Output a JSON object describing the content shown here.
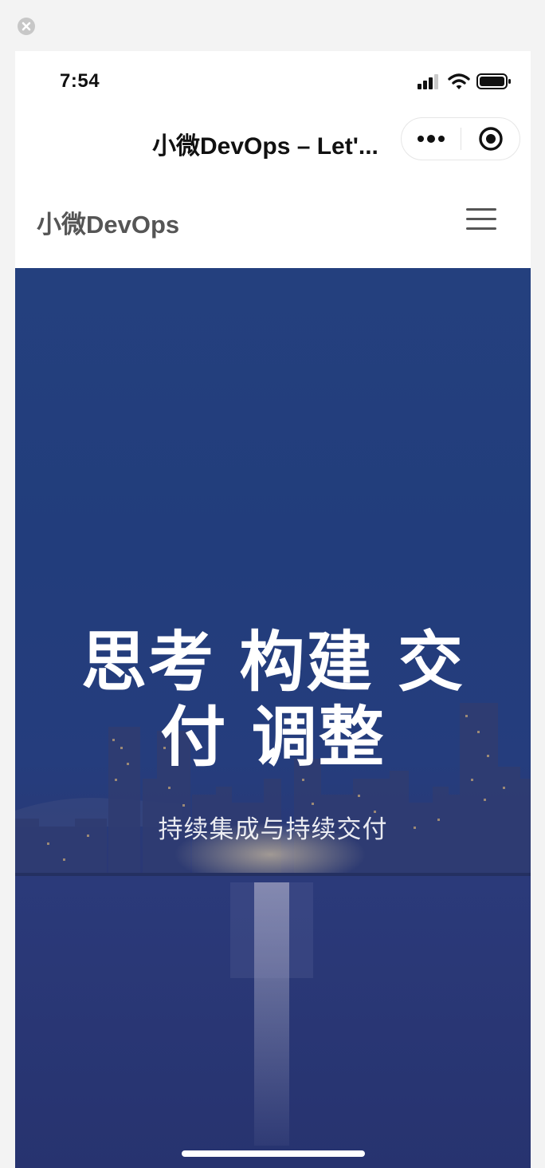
{
  "status_bar": {
    "time": "7:54"
  },
  "mini_program": {
    "title": "小微DevOps – Let'...",
    "icons": [
      "more-icon",
      "exit-target-icon"
    ]
  },
  "site": {
    "brand": "小微DevOps"
  },
  "hero": {
    "title": "思考 构建 交付 调整",
    "subtitle": "持续集成与持续交付"
  },
  "colors": {
    "hero_background": "#233f7d",
    "brand_text": "#555555",
    "page_background": "#f3f3f3"
  }
}
